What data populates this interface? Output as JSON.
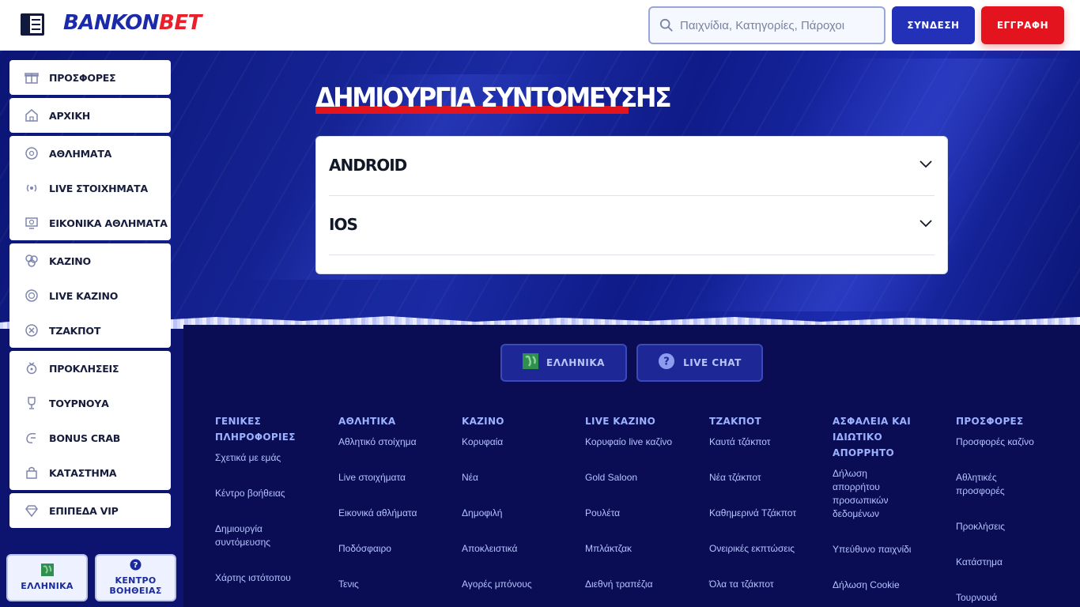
{
  "header": {
    "brand_part1": "BANKON",
    "brand_part2": "BET",
    "search_placeholder": "Παιχνίδια, Κατηγορίες, Πάροχοι",
    "login_label": "ΣΥΝΔΕΣΗ",
    "register_label": "ΕΓΓΡΑΦΗ"
  },
  "sidebar": {
    "groups": [
      [
        {
          "label": "ΠΡΟΣΦΟΡΕΣ",
          "icon": "gift-icon"
        }
      ],
      [
        {
          "label": "ΑΡΧΙΚΗ",
          "icon": "home-icon"
        }
      ],
      [
        {
          "label": "ΑΘΛΗΜΑΤΑ",
          "icon": "soccer-ball-icon"
        },
        {
          "label": "LIVE ΣΤΟΙΧΗΜΑΤΑ",
          "icon": "live-broadcast-icon"
        },
        {
          "label": "ΕΙΚΟΝΙΚΑ ΑΘΛΗΜΑΤΑ",
          "icon": "virtual-screen-icon"
        }
      ],
      [
        {
          "label": "ΚΑΖΙΝΟ",
          "icon": "dice-icon"
        },
        {
          "label": "LIVE ΚΑΖΙΝΟ",
          "icon": "chip-icon"
        },
        {
          "label": "ΤΖΑΚΠΟΤ",
          "icon": "jackpot-icon"
        }
      ],
      [
        {
          "label": "ΠΡΟΚΛΗΣΕΙΣ",
          "icon": "medal-icon"
        },
        {
          "label": "ΤΟΥΡΝΟΥΑ",
          "icon": "trophy-icon"
        },
        {
          "label": "BONUS CRAB",
          "icon": "claw-icon"
        },
        {
          "label": "ΚΑΤΑΣΤΗΜΑ",
          "icon": "shopping-bag-icon"
        }
      ],
      [
        {
          "label": "ΕΠΙΠΕΔΑ VIP",
          "icon": "diamond-icon"
        }
      ]
    ],
    "language_label": "ΕΛΛΗΝΙΚΑ",
    "help_label_line1": "ΚΕΝΤΡΟ",
    "help_label_line2": "ΒΟΗΘΕΙΑΣ"
  },
  "main": {
    "title": "ΔΗΜΙΟΥΡΓΙΑ ΣΥΝΤΟΜΕΥΣΗΣ",
    "accordion": [
      "ANDROID",
      "IOS"
    ]
  },
  "footer": {
    "language_label": "ΕΛΛΗΝΙΚΑ",
    "live_chat_label": "LIVE CHAT",
    "columns": [
      {
        "heading": "ΓΕΝΙΚΕΣ ΠΛΗΡΟΦΟΡΙΕΣ",
        "links": [
          "Σχετικά με εμάς",
          "Κέντρο βοήθειας",
          "Δημιουργία συντόμευσης",
          "Χάρτης ιστότοπου"
        ]
      },
      {
        "heading": "ΑΘΛΗΤΙΚΑ",
        "links": [
          "Αθλητικό στοίχημα",
          "Live στοιχήματα",
          "Εικονικά αθλήματα",
          "Ποδόσφαιρο",
          "Τενις"
        ]
      },
      {
        "heading": "ΚΑΖΙΝΟ",
        "links": [
          "Κορυφαία",
          "Νέα",
          "Δημοφιλή",
          "Αποκλειστικά",
          "Αγορές μπόνους"
        ]
      },
      {
        "heading": "LIVE ΚΑΖΙΝΟ",
        "links": [
          "Κορυφαίο live καζίνο",
          "Gold Saloon",
          "Ρουλέτα",
          "Μπλάκτζακ",
          "Διεθνή τραπέζια"
        ]
      },
      {
        "heading": "ΤΖΑΚΠΟΤ",
        "links": [
          "Καυτά τζάκποτ",
          "Νέα τζάκποτ",
          "Καθημερινά Τζάκποτ",
          "Ονειρικές εκπτώσεις",
          "Όλα τα τζάκποτ"
        ]
      },
      {
        "heading": "ΑΣΦΑΛΕΙΑ ΚΑΙ ΙΔΙΩΤΙΚΟ ΑΠΟΡΡΗΤΟ",
        "links": [
          "Δήλωση απορρήτου προσωπικών δεδομένων",
          "Υπεύθυνο παιχνίδι",
          "Δήλωση Cookie"
        ]
      },
      {
        "heading": "ΠΡΟΣΦΟΡΕΣ",
        "links": [
          "Προσφορές καζίνο",
          "Αθλητικές προσφορές",
          "Προκλήσεις",
          "Κατάστημα",
          "Τουρνουά"
        ]
      }
    ]
  },
  "colors": {
    "brand_blue": "#1b2aa8",
    "brand_red": "#e4141f",
    "footer_bg": "#0b0d54"
  }
}
